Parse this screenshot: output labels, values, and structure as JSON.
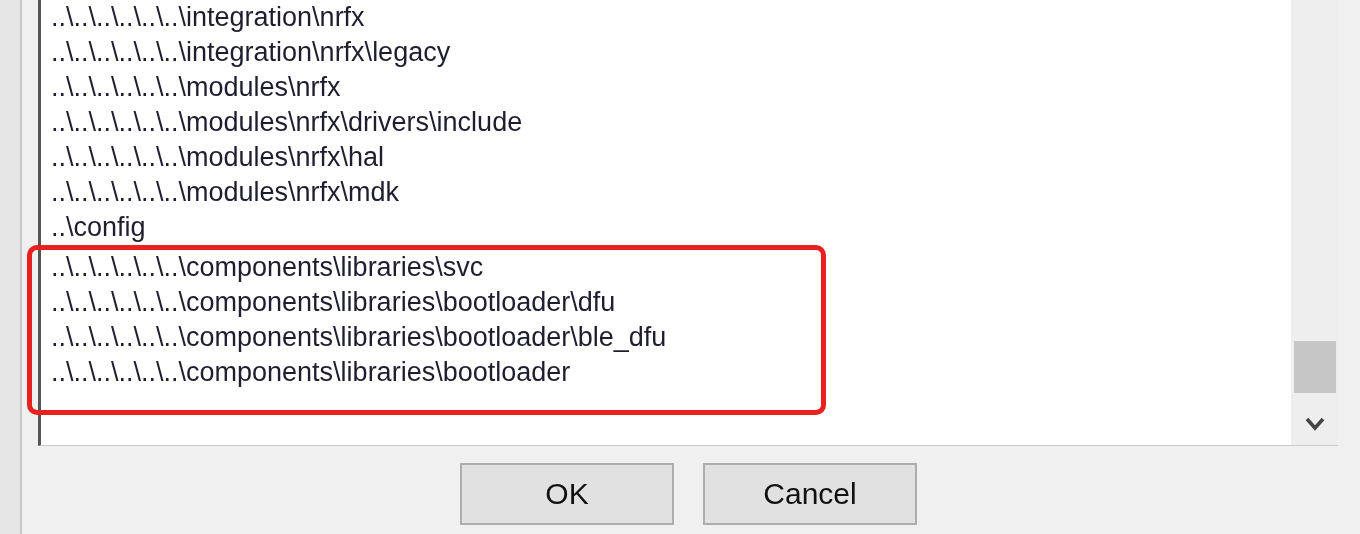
{
  "include_paths": [
    {
      "path": "..\\..\\..\\..\\..\\..\\integration\\nrfx",
      "highlighted": false
    },
    {
      "path": "..\\..\\..\\..\\..\\..\\integration\\nrfx\\legacy",
      "highlighted": false
    },
    {
      "path": "..\\..\\..\\..\\..\\..\\modules\\nrfx",
      "highlighted": false
    },
    {
      "path": "..\\..\\..\\..\\..\\..\\modules\\nrfx\\drivers\\include",
      "highlighted": false
    },
    {
      "path": "..\\..\\..\\..\\..\\..\\modules\\nrfx\\hal",
      "highlighted": false
    },
    {
      "path": "..\\..\\..\\..\\..\\..\\modules\\nrfx\\mdk",
      "highlighted": false
    },
    {
      "path": "..\\config",
      "highlighted": false
    },
    {
      "path": "..\\..\\..\\..\\..\\..\\components\\libraries\\svc",
      "highlighted": true
    },
    {
      "path": "..\\..\\..\\..\\..\\..\\components\\libraries\\bootloader\\dfu",
      "highlighted": true
    },
    {
      "path": "..\\..\\..\\..\\..\\..\\components\\libraries\\bootloader\\ble_dfu",
      "highlighted": true
    },
    {
      "path": "..\\..\\..\\..\\..\\..\\components\\libraries\\bootloader",
      "highlighted": true
    }
  ],
  "buttons": [
    {
      "label": "OK"
    },
    {
      "label": "Cancel"
    }
  ]
}
